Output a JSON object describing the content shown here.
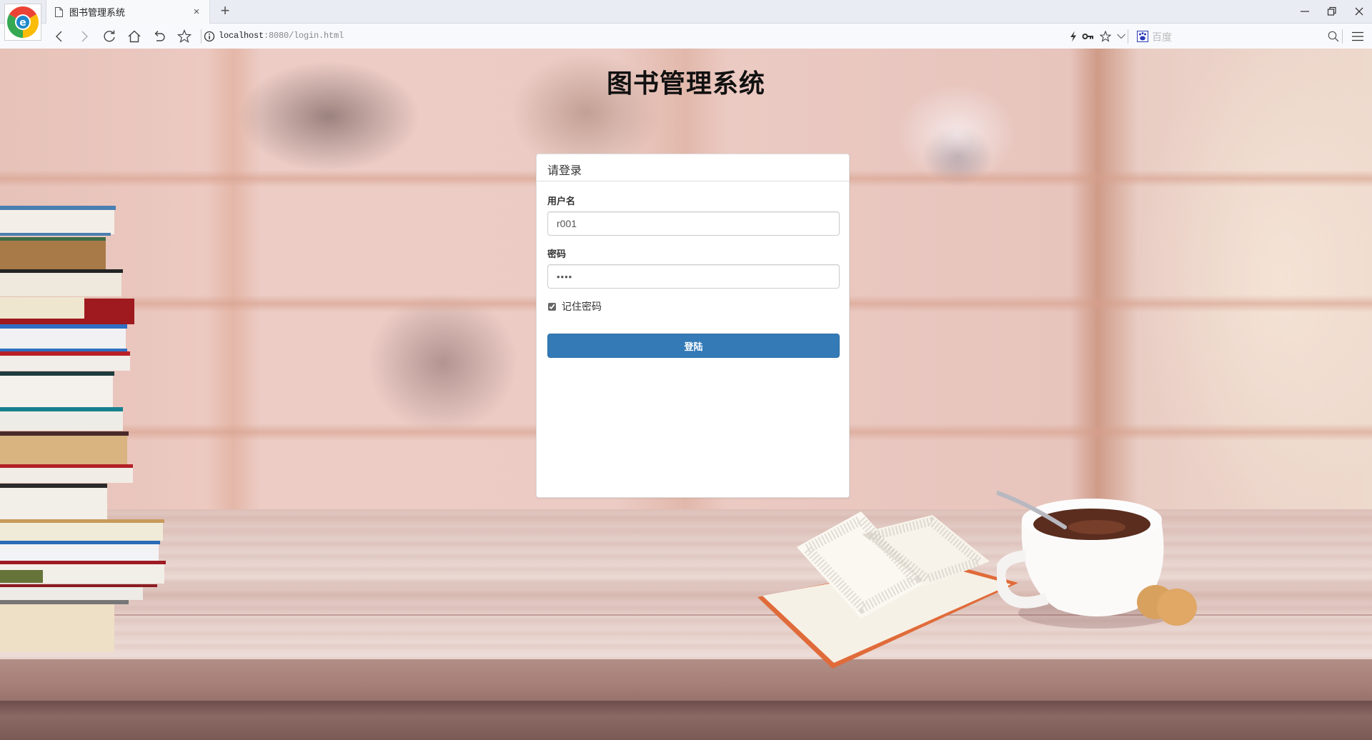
{
  "browser": {
    "tab_title": "图书管理系统",
    "new_tab_label": "+",
    "tab_close_label": "×",
    "url_host": "localhost",
    "url_rest": ":8080/login.html",
    "search_engine_placeholder": "百度",
    "icons": [
      "browser-logo",
      "back",
      "forward",
      "reload",
      "home",
      "undo",
      "bookmark-star",
      "site-info",
      "bolt",
      "key",
      "favorite-star",
      "chevron-down",
      "baidu-paw",
      "search",
      "menu",
      "minimize",
      "restore",
      "close"
    ]
  },
  "page": {
    "app_title": "图书管理系统",
    "login_panel": {
      "heading": "请登录",
      "username_label": "用户名",
      "username_value": "r001",
      "password_label": "密码",
      "password_value": "••••",
      "remember_label": "记住密码",
      "remember_checked": true,
      "submit_label": "登陆"
    }
  },
  "colors": {
    "primary_button": "#337ab7",
    "tab_bar": "#e9ecf3",
    "address_bar": "#f8f9fc"
  }
}
